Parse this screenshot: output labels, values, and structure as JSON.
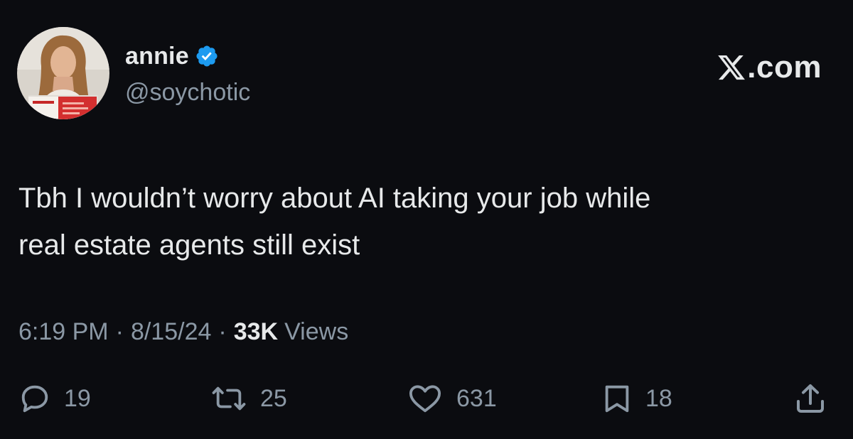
{
  "author": {
    "display_name": "annie",
    "handle": "@soychotic",
    "verified": true
  },
  "site": {
    "logo_suffix": ".com"
  },
  "tweet": {
    "line1": "Tbh I wouldn’t worry about AI taking your job while",
    "line2": "real estate agents still exist"
  },
  "meta": {
    "time": "6:19 PM",
    "date": "8/15/24",
    "separator": "·",
    "views_count": "33K",
    "views_label": "Views"
  },
  "actions": {
    "replies": "19",
    "reposts": "25",
    "likes": "631",
    "bookmarks": "18"
  },
  "icons": {
    "avatar": "profile-photo",
    "verified": "verified-badge-icon",
    "logo": "x-logo-icon",
    "reply": "reply-icon",
    "repost": "repost-icon",
    "like": "heart-icon",
    "bookmark": "bookmark-icon",
    "share": "share-icon"
  },
  "colors": {
    "background": "#0b0c10",
    "text": "#e7e9ea",
    "secondary_text": "#8b98a5",
    "verified_blue": "#1d9bf0"
  }
}
